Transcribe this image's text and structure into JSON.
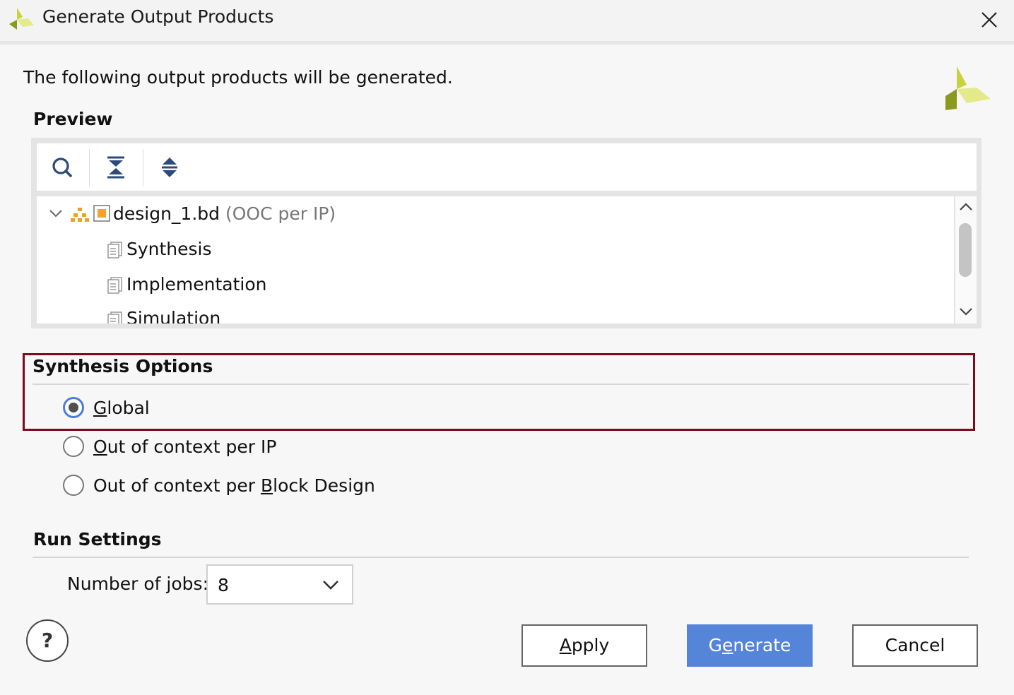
{
  "window": {
    "title": "Generate Output Products"
  },
  "intro_text": "The following output products will be generated.",
  "preview": {
    "title": "Preview",
    "toolbar": [
      "search-icon",
      "collapse-all-icon",
      "expand-all-icon"
    ],
    "tree": {
      "root": {
        "name": "design_1.bd",
        "annotation": "(OOC per IP)",
        "expanded": true
      },
      "children": [
        "Synthesis",
        "Implementation",
        "Simulation"
      ]
    }
  },
  "synthesis_options": {
    "title": "Synthesis Options",
    "options": [
      {
        "pre": "",
        "mnemonic": "G",
        "post": "lobal",
        "selected": true
      },
      {
        "pre": "",
        "mnemonic": "O",
        "post": "ut of context per IP",
        "selected": false
      },
      {
        "pre": "Out of context per ",
        "mnemonic": "B",
        "post": "lock Design",
        "selected": false
      }
    ]
  },
  "run_settings": {
    "title": "Run Settings",
    "jobs_label": {
      "pre": "Number of ",
      "mnemonic": "j",
      "post": "obs:"
    },
    "jobs_value": "8"
  },
  "buttons": {
    "help": "?",
    "apply": {
      "mnemonic": "A",
      "post": "pply"
    },
    "generate": {
      "pre": "G",
      "mnemonic": "e",
      "post": "nerate"
    },
    "cancel": "Cancel"
  },
  "colors": {
    "accent": "#5585d8",
    "highlight_frame": "#7d0a1f",
    "logo_dark": "#8a9a1e",
    "logo_light": "#d7e04a"
  }
}
